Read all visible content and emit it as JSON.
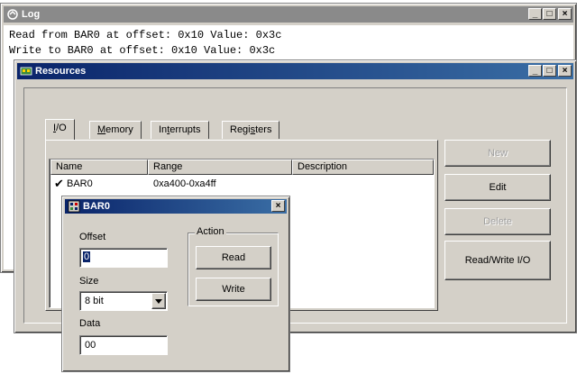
{
  "log_window": {
    "title": "Log",
    "lines": [
      "Read from BAR0 at offset: 0x10 Value: 0x3c",
      "Write to BAR0 at offset: 0x10 Value: 0x3c"
    ]
  },
  "resources_window": {
    "title": "Resources",
    "tabs": [
      {
        "label": "I/O",
        "mnemonic": "I"
      },
      {
        "label": "Memory",
        "mnemonic": "M"
      },
      {
        "label": "Interrupts",
        "mnemonic": "t"
      },
      {
        "label": "Registers",
        "mnemonic": "s"
      }
    ],
    "columns": [
      "Name",
      "Range",
      "Description"
    ],
    "rows": [
      {
        "name": "BAR0",
        "range": "0xa400-0xa4ff",
        "description": ""
      }
    ],
    "buttons": {
      "new": "New",
      "edit": "Edit",
      "delete": "Delete",
      "read_write": "Read/Write I/O"
    }
  },
  "bar_dialog": {
    "title": "BAR0",
    "offset_label": "Offset",
    "offset_value": "0",
    "size_label": "Size",
    "size_value": "8 bit",
    "data_label": "Data",
    "data_value": "00",
    "action_label": "Action",
    "read_label": "Read",
    "write_label": "Write"
  },
  "window_controls": {
    "minimize": "_",
    "maximize": "□",
    "close": "×"
  }
}
